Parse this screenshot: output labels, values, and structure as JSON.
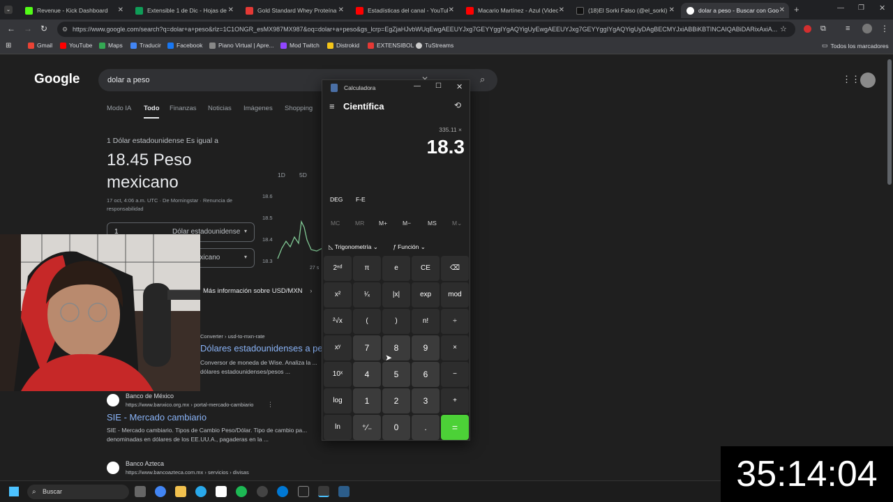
{
  "browser": {
    "tabs": [
      {
        "label": "Revenue - Kick Dashboard",
        "color": "#53fc18"
      },
      {
        "label": "Extensible 1 de Dic - Hojas de cálculo",
        "color": "#0f9d58"
      },
      {
        "label": "Gold Standard Whey Proteína",
        "color": "#e53935"
      },
      {
        "label": "Estadísticas del canal - YouTube",
        "color": "#ff0000"
      },
      {
        "label": "Macario Martínez - Azul (Video)",
        "color": "#ff0000"
      },
      {
        "label": "(18)El Sorki Falso (@el_sorki) | TikTok",
        "color": "#111111"
      },
      {
        "label": "dolar a peso - Buscar con Google",
        "color": "#4285f4"
      }
    ],
    "url": "https://www.google.com/search?q=dolar+a+peso&rlz=1C1ONGR_esMX987MX987&oq=dolar+a+peso&gs_lcrp=EgZjaHJvbWUqEwgAEEUYJxg7GEYYggIYgAQYigUyEwgAEEUYJxg7GEYYggIYgAQYigUyDAgBECMYJxiABBiKBTINCAIQABiDARixAxiA...",
    "bookmarks": [
      {
        "label": "Gmail",
        "color": "#ea4335"
      },
      {
        "label": "YouTube",
        "color": "#ff0000"
      },
      {
        "label": "Maps",
        "color": "#34a853"
      },
      {
        "label": "Traducir",
        "color": "#4285f4"
      },
      {
        "label": "Facebook",
        "color": "#1877f2"
      },
      {
        "label": "Piano Virtual | Apre...",
        "color": "#888888"
      },
      {
        "label": "Mod Twitch",
        "color": "#9146ff"
      },
      {
        "label": "Distrokid",
        "color": "#f5c518"
      },
      {
        "label": "EXTENSIBOL",
        "color": "#e53935"
      },
      {
        "label": "TuStreams",
        "color": "#cccccc"
      }
    ],
    "all_bookmarks": "Todos los marcadores"
  },
  "google": {
    "logo": "Google",
    "query": "dolar a peso",
    "tabs": [
      "Modo IA",
      "Todo",
      "Finanzas",
      "Noticias",
      "Imágenes",
      "Shopping"
    ],
    "active_tab": "Todo",
    "conversion": {
      "intro": "1 Dólar estadounidense Es igual a",
      "result": "18.45 Peso mexicano",
      "meta": "17 oct, 4:06 a.m. UTC · De Morningstar · Renuncia de responsabilidad",
      "amount": "1",
      "from_currency": "Dólar estadounidense",
      "to_currency": "Peso mexicano",
      "more_info": "Más información sobre USD/MXN",
      "ranges": [
        "1D",
        "5D"
      ],
      "y_ticks": [
        "18.6",
        "18.5",
        "18.4",
        "18.3"
      ],
      "x_tick": "27 s"
    },
    "results": [
      {
        "breadcrumb": "Converter › usd-to-mxn-rate",
        "title": "Dólares estadounidenses a pesos mexicanos",
        "snippet": "Conversor de moneda de Wise. Analiza la ... dólares estadounidenses/pesos ..."
      },
      {
        "site": "Banco de México",
        "url": "https://www.banxico.org.mx › portal-mercado-cambiario",
        "title": "SIE - Mercado cambiario",
        "snippet": "SIE - Mercado cambiario. Tipos de Cambio Peso/Dólar. Tipo de cambio pa... denominadas en dólares de los EE.UU.A., pagaderas en la ..."
      },
      {
        "site": "Banco Azteca",
        "url": "https://www.bancoazteca.com.mx › servicios › divisas"
      }
    ]
  },
  "calculator": {
    "window_title": "Calculadora",
    "mode": "Científica",
    "expression": "335.11 ×",
    "display": "18.3",
    "deg": "DEG",
    "fe": "F-E",
    "memory": [
      "MC",
      "MR",
      "M+",
      "M−",
      "MS",
      "M⌄"
    ],
    "trig": "Trigonometría",
    "func": "Función",
    "keys": [
      [
        "2ⁿᵈ",
        "π",
        "e",
        "CE",
        "⌫"
      ],
      [
        "x²",
        "¹⁄ₓ",
        "|x|",
        "exp",
        "mod"
      ],
      [
        "²√x",
        "(",
        ")",
        "n!",
        "÷"
      ],
      [
        "xʸ",
        "7",
        "8",
        "9",
        "×"
      ],
      [
        "10ˣ",
        "4",
        "5",
        "6",
        "−"
      ],
      [
        "log",
        "1",
        "2",
        "3",
        "+"
      ],
      [
        "ln",
        "⁺∕₋",
        "0",
        ".",
        "="
      ]
    ]
  },
  "overlay": {
    "timer": "35:14:04"
  },
  "taskbar": {
    "search": "Buscar"
  }
}
